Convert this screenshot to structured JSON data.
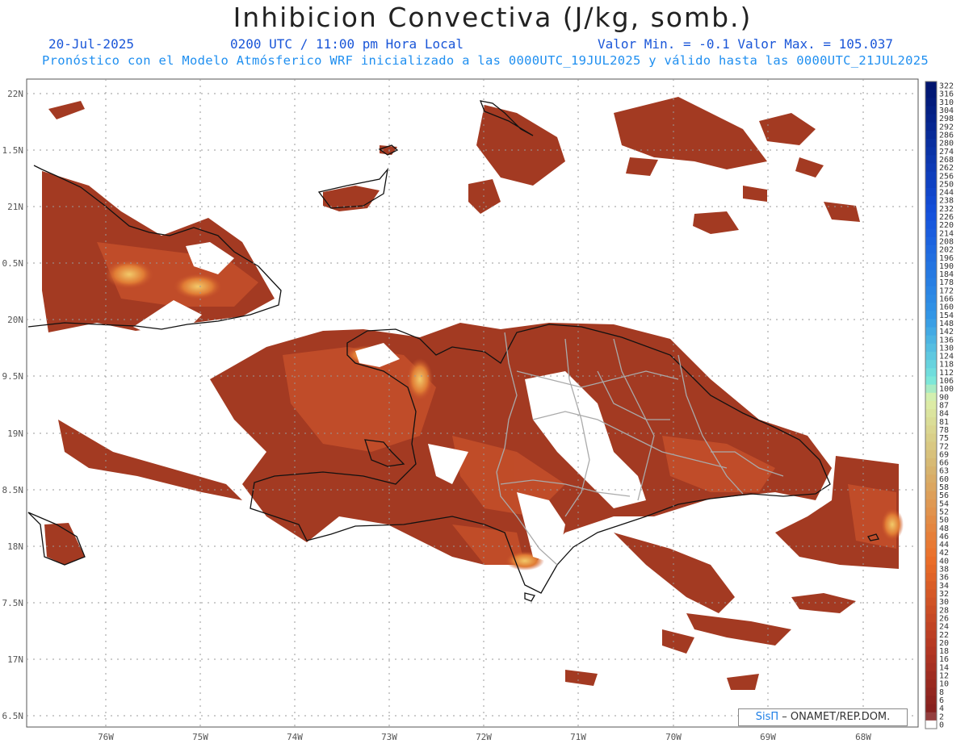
{
  "header": {
    "title": "Inhibicion Convectiva (J/kg, somb.)",
    "date": "20-Jul-2025",
    "time": "0200 UTC / 11:00 pm Hora Local",
    "min_max": "Valor Min. = -0.1  Valor Max. = 105.037",
    "model_line": "Pronóstico con el Modelo Atmósferico WRF inicializado a las 0000UTC_19JUL2025 y válido hasta las  0000UTC_21JUL2025"
  },
  "axes": {
    "lat_labels": [
      "22N",
      "1.5N",
      "21N",
      "0.5N",
      "20N",
      "9.5N",
      "19N",
      "8.5N",
      "18N",
      "7.5N",
      "17N",
      "6.5N"
    ],
    "lon_labels": [
      "76W",
      "75W",
      "74W",
      "73W",
      "72W",
      "71W",
      "70W",
      "69W",
      "68W"
    ]
  },
  "colorbar": {
    "labels": [
      "322",
      "316",
      "310",
      "304",
      "298",
      "292",
      "286",
      "280",
      "274",
      "268",
      "262",
      "256",
      "250",
      "244",
      "238",
      "232",
      "226",
      "220",
      "214",
      "208",
      "202",
      "196",
      "190",
      "184",
      "178",
      "172",
      "166",
      "160",
      "154",
      "148",
      "142",
      "136",
      "130",
      "124",
      "118",
      "112",
      "106",
      "100",
      "90",
      "87",
      "84",
      "81",
      "78",
      "75",
      "72",
      "69",
      "66",
      "63",
      "60",
      "58",
      "56",
      "54",
      "52",
      "50",
      "48",
      "46",
      "44",
      "42",
      "40",
      "38",
      "36",
      "34",
      "32",
      "30",
      "28",
      "26",
      "24",
      "22",
      "20",
      "18",
      "16",
      "14",
      "12",
      "10",
      "8",
      "6",
      "4",
      "2",
      "0"
    ]
  },
  "credit": {
    "brand": "SisΠ",
    "text": "– ONAMET/REP.DOM."
  },
  "colors": {
    "field_base": "#a33a22",
    "field_mid": "#c6502a",
    "field_hi": "#e8883a",
    "coast": "#111111",
    "border": "#aaaaaa",
    "grid": "#999999"
  }
}
